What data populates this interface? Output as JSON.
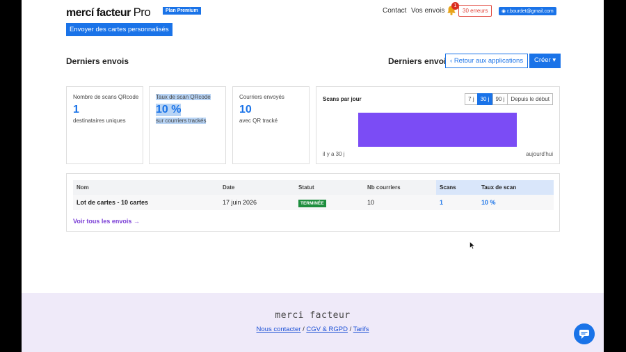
{
  "header": {
    "logo_main": "mercí facteur",
    "logo_pro": "Pro",
    "plan_badge": "Plan Premium",
    "nav_contact": "Contact",
    "nav_sends": "Vos envois",
    "notification_count": "1",
    "errors_button": "30 erreurs",
    "user_button": "r.bourdet@gmail.com",
    "send_cards_button": "Envoyer des cartes personnalisés"
  },
  "section": {
    "title_left": "Derniers envois",
    "title_right": "Derniers envois",
    "back_button": "Retour aux applications",
    "create_button": "Créer"
  },
  "stats": [
    {
      "label": "Nombre de scans QRcode",
      "value": "1",
      "sub": "destinataires uniques"
    },
    {
      "label": "Taux de scan QRcode",
      "value": "10 %",
      "sub": "sur courriers trackés"
    },
    {
      "label": "Courriers envoyés",
      "value": "10",
      "sub": "avec QR tracké"
    }
  ],
  "scans_chart": {
    "title": "Scans par jour",
    "ranges": [
      "7 j",
      "30 j",
      "90 j",
      "Depuis le début"
    ],
    "active_range": "30 j",
    "x_start_label": "il y a 30 j",
    "x_end_label": "aujourd'hui",
    "bar_color": "#7b4cf5"
  },
  "chart_data": {
    "type": "bar",
    "title": "Scans par jour",
    "categories": [
      "il y a 30 j",
      "aujourd'hui"
    ],
    "values": [
      1
    ],
    "xlabel": "",
    "ylabel": ""
  },
  "table": {
    "columns": [
      "Nom",
      "Date",
      "Statut",
      "Nb courriers",
      "Scans",
      "Taux de scan"
    ],
    "rows": [
      {
        "name": "Lot de cartes - 10 cartes",
        "date": "17 juin 2026",
        "status": "TERMINÉE",
        "count": "10",
        "scans": "1",
        "rate": "10 %"
      }
    ],
    "see_all": "Voir tous les envois →"
  },
  "footer": {
    "brand": "merci facteur",
    "link_contact": "Nous contacter",
    "link_cgv": "CGV & RGPD",
    "link_tarifs": "Tarifs",
    "separator": "/"
  },
  "colors": {
    "primary": "#1a73e8",
    "error": "#e0443a",
    "success": "#1e8e3e",
    "footer_bg": "#efeaf9"
  }
}
